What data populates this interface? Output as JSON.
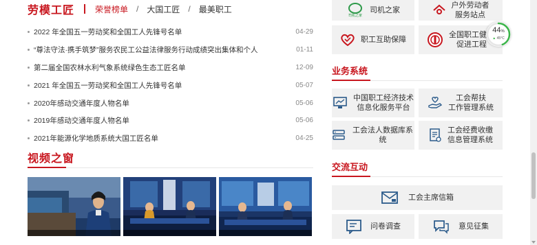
{
  "left": {
    "title": "劳模工匠",
    "tabs": [
      "荣誉榜单",
      "大国工匠",
      "最美职工"
    ],
    "news": [
      {
        "title": "2022 年全国五一劳动奖和全国工人先锋号名单",
        "date": "04-29"
      },
      {
        "title": "“尊法守法·携手筑梦”服务农民工公益法律服务行动成绩突出集体和个人",
        "date": "01-11"
      },
      {
        "title": "第二届全国农林水利气象系统绿色生态工匠名单",
        "date": "12-09"
      },
      {
        "title": "2021 年全国五一劳动奖和全国工人先锋号名单",
        "date": "05-07"
      },
      {
        "title": "2020年感动交通年度人物名单",
        "date": "05-06"
      },
      {
        "title": "2019年感动交通年度人物名单",
        "date": "05-06"
      },
      {
        "title": "2021年能源化学地质系统大国工匠名单",
        "date": "04-25"
      }
    ],
    "video_title": "视频之窗"
  },
  "right": {
    "top_cards": [
      {
        "label": "司机之家",
        "icon": "driver-home-icon"
      },
      {
        "label": "户外劳动者\n服务站点",
        "icon": "outdoor-station-icon"
      },
      {
        "label": "职工互助保障",
        "icon": "heart-icon"
      },
      {
        "label": "全国职工健康\n促进工程",
        "icon": "union-emblem-icon"
      }
    ],
    "business_title": "业务系统",
    "business_cards": [
      {
        "label": "中国职工经济技术\n信息化服务平台",
        "icon": "monitor-chart-icon"
      },
      {
        "label": "工会帮扶\n工作管理系统",
        "icon": "helping-hand-icon"
      },
      {
        "label": "工会法人数据库系统",
        "icon": "database-icon"
      },
      {
        "label": "工会经费收缴\n信息管理系统",
        "icon": "fee-document-icon"
      }
    ],
    "exchange_title": "交流互动",
    "mailbox_label": "工会主席信箱",
    "survey_label": "问卷调查",
    "feedback_label": "意见征集"
  },
  "gauge": {
    "percent": "44",
    "unit": "%",
    "temp": "45°C"
  },
  "colors": {
    "brand_red": "#c8161e",
    "card_bg": "#f1f1f1",
    "icon_blue": "#2a5a8a"
  }
}
